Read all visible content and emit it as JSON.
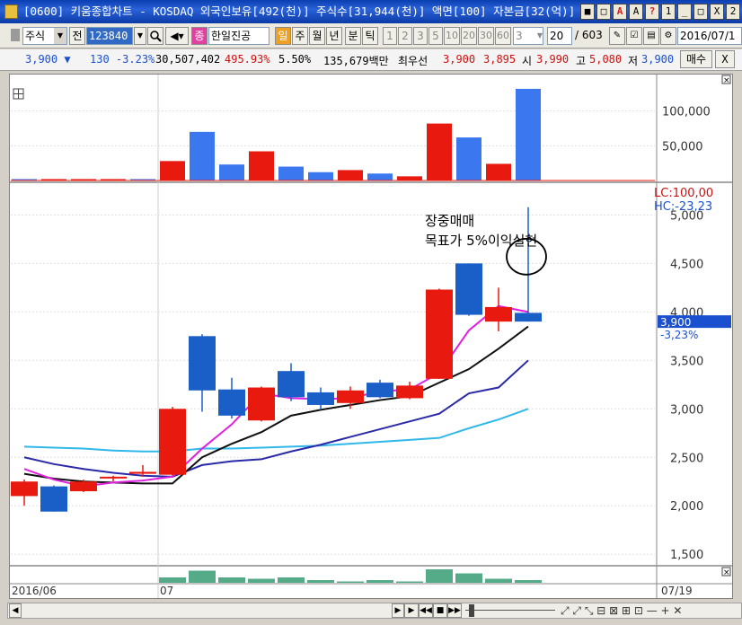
{
  "window": {
    "title": "[0600] 키움종합차트 - KOSDAQ 외국인보유[492(천)] 주식수[31,944(천)] 액면[100] 자본금[32(억)] 결",
    "buttons": [
      "■",
      "□",
      "A",
      "A",
      "?",
      "1",
      "_",
      "□",
      "X",
      "2"
    ]
  },
  "toolbar": {
    "market_label": "주식",
    "all_label": "전",
    "code_value": "123840",
    "company_name": "한일진공",
    "period_buttons": [
      "일",
      "주",
      "월",
      "년",
      "분",
      "틱"
    ],
    "minute_options": [
      "1",
      "2",
      "3",
      "5",
      "10",
      "20",
      "30",
      "60"
    ],
    "minute_input": "3",
    "count_value": "20",
    "count_total": "/ 603",
    "date_value": "2016/07/1",
    "icon_names": [
      "ai-icon",
      "checkbox-icon",
      "chart-icon",
      "print-icon",
      "settings-icon"
    ]
  },
  "quote": {
    "price": "3,900",
    "arrow": "▼",
    "change": "130",
    "change_pct": "-3.23%",
    "volume": "30,507,402",
    "volume_ratio": "495.93%",
    "turnover": "5.50%",
    "amount": "135,679백만",
    "best_label": "최우선",
    "ask": "3,900",
    "bid": "3,895",
    "open_label": "시",
    "open": "3,990",
    "high_label": "고",
    "high": "5,080",
    "low_label": "저",
    "low": "3,900",
    "buy_label": "매수"
  },
  "colors": {
    "up": "#e8190e",
    "down": "#1a5fc8",
    "volume_up": "#e8190e",
    "volume_down": "#3b78f0",
    "ma5": "#e020e0",
    "ma10": "#101010",
    "ma20": "#2a2aa8",
    "ma60": "#30b8e8",
    "foreign": "#55aa88"
  },
  "chart_data": {
    "type": "candlestick",
    "candles": [
      {
        "o": 2100,
        "c": 2250,
        "h": 2270,
        "l": 2000
      },
      {
        "o": 2200,
        "c": 1940,
        "h": 2210,
        "l": 1940
      },
      {
        "o": 2150,
        "c": 2250,
        "h": 2270,
        "l": 2140
      },
      {
        "o": 2290,
        "c": 2300,
        "h": 2310,
        "l": 2250
      },
      {
        "o": 2330,
        "c": 2350,
        "h": 2420,
        "l": 2300
      },
      {
        "o": 2320,
        "c": 3000,
        "h": 3020,
        "l": 2310
      },
      {
        "o": 3750,
        "c": 3190,
        "h": 3770,
        "l": 2970
      },
      {
        "o": 3200,
        "c": 2930,
        "h": 3320,
        "l": 2900
      },
      {
        "o": 2880,
        "c": 3220,
        "h": 3230,
        "l": 2870
      },
      {
        "o": 3390,
        "c": 3120,
        "h": 3470,
        "l": 3080
      },
      {
        "o": 3170,
        "c": 3040,
        "h": 3220,
        "l": 2990
      },
      {
        "o": 3060,
        "c": 3190,
        "h": 3230,
        "l": 3000
      },
      {
        "o": 3270,
        "c": 3120,
        "h": 3300,
        "l": 3110
      },
      {
        "o": 3110,
        "c": 3240,
        "h": 3280,
        "l": 3100
      },
      {
        "o": 3310,
        "c": 4230,
        "h": 4240,
        "l": 3310
      },
      {
        "o": 4500,
        "c": 3970,
        "h": 4500,
        "l": 3960
      },
      {
        "o": 3900,
        "c": 4050,
        "h": 4250,
        "l": 3800
      },
      {
        "o": 3990,
        "c": 3900,
        "h": 5080,
        "l": 3900
      }
    ],
    "volume_bars": [
      {
        "v": 2000,
        "up": false
      },
      {
        "v": 2000,
        "up": true
      },
      {
        "v": 2000,
        "up": true
      },
      {
        "v": 2000,
        "up": true
      },
      {
        "v": 2000,
        "up": false
      },
      {
        "v": 28000,
        "up": true
      },
      {
        "v": 70000,
        "up": false
      },
      {
        "v": 23000,
        "up": false
      },
      {
        "v": 42000,
        "up": true
      },
      {
        "v": 20000,
        "up": false
      },
      {
        "v": 12000,
        "up": false
      },
      {
        "v": 15000,
        "up": true
      },
      {
        "v": 10000,
        "up": false
      },
      {
        "v": 6000,
        "up": true
      },
      {
        "v": 82000,
        "up": true
      },
      {
        "v": 62000,
        "up": false
      },
      {
        "v": 24000,
        "up": true
      },
      {
        "v": 132000,
        "up": false
      }
    ],
    "volume_ticks": [
      "100,000",
      "50,000"
    ],
    "volume_tick_values": [
      100000,
      50000
    ],
    "price_ticks": [
      "5,000",
      "4,500",
      "4,000",
      "3,500",
      "3,000",
      "2,500",
      "2,000",
      "1,500"
    ],
    "price_tick_values": [
      5000,
      4500,
      4000,
      3500,
      3000,
      2500,
      2000,
      1500
    ],
    "ma5": [
      2380,
      2270,
      2200,
      2240,
      2260,
      2300,
      2590,
      2840,
      3160,
      3110,
      3100,
      3110,
      3180,
      3200,
      3370,
      3810,
      4060,
      4000
    ],
    "ma10": [
      2330,
      2280,
      2250,
      2240,
      2230,
      2230,
      2500,
      2640,
      2760,
      2930,
      2990,
      3040,
      3090,
      3130,
      3270,
      3410,
      3620,
      3850
    ],
    "ma20": [
      2500,
      2430,
      2380,
      2340,
      2310,
      2300,
      2420,
      2460,
      2480,
      2560,
      2630,
      2710,
      2790,
      2870,
      2950,
      3160,
      3220,
      3500
    ],
    "ma60": [
      2610,
      2600,
      2590,
      2570,
      2560,
      2560,
      2590,
      2590,
      2600,
      2610,
      2620,
      2640,
      2660,
      2680,
      2700,
      2800,
      2890,
      3000
    ],
    "foreign": [
      0,
      0,
      0,
      0,
      0,
      4,
      9,
      4,
      3,
      4,
      2,
      1,
      2,
      1,
      10,
      7,
      3,
      2
    ],
    "range_labels": {
      "lc": "LC:100,00",
      "hc": "HC:-23,23"
    },
    "current_price_tag": "3,900",
    "current_pct_tag": "-3,23%",
    "annotation": {
      "line1": "장중매매",
      "line2": "목표가 5%이익실현"
    },
    "x_labels": {
      "start": "2016/06",
      "mid": "07",
      "end": "07/19"
    }
  }
}
